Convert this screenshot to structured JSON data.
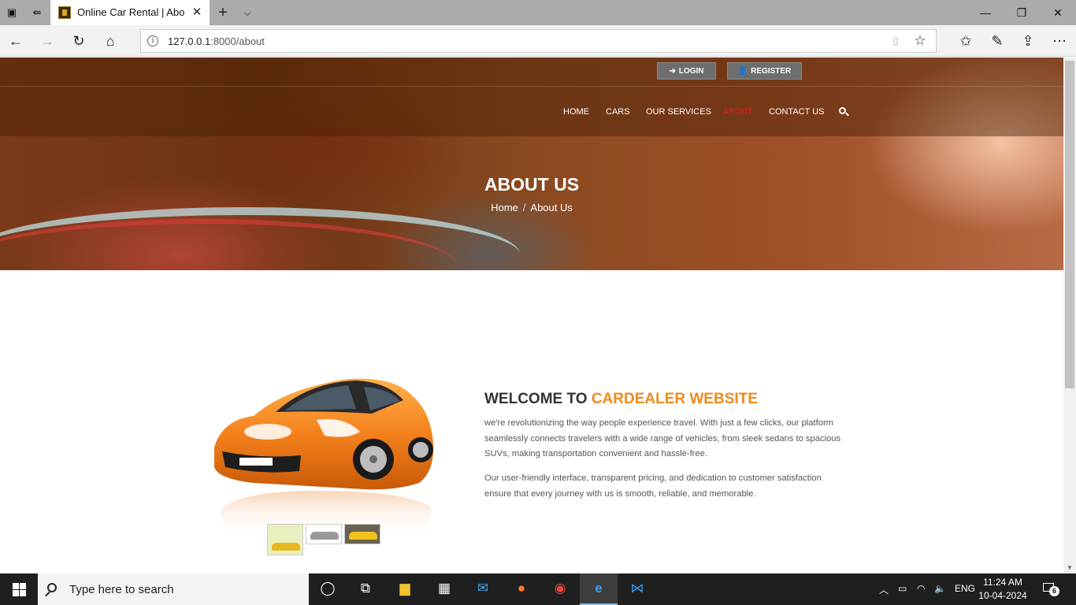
{
  "browser": {
    "tab_title": "Online Car Rental | About",
    "url_host": "127.0.0.1",
    "url_path": ":8000/about"
  },
  "header": {
    "login_label": "LOGIN",
    "register_label": "REGISTER",
    "menu": [
      {
        "label": "HOME",
        "active": false
      },
      {
        "label": "CARS",
        "active": false
      },
      {
        "label": "OUR SERVICES",
        "active": false
      },
      {
        "label": "ABOUT",
        "active": true
      },
      {
        "label": "CONTACT US",
        "active": false
      }
    ]
  },
  "hero": {
    "title": "ABOUT US",
    "breadcrumb_home": "Home",
    "breadcrumb_sep": "/",
    "breadcrumb_current": "About Us"
  },
  "about": {
    "heading_prefix": "WELCOME TO ",
    "heading_highlight": "CARDEALER WEBSITE",
    "paragraph_1": "we're revolutionizing the way people experience travel. With just a few clicks, our platform seamlessly connects travelers with a wide range of vehicles, from sleek sedans to spacious SUVs, making transportation convenient and hassle-free.",
    "paragraph_2": "Our user-friendly interface, transparent pricing, and dedication to customer satisfaction ensure that every journey with us is smooth, reliable, and memorable.",
    "accent_color": "#f08a1c"
  },
  "taskbar": {
    "search_placeholder": "Type here to search",
    "language": "ENG",
    "time": "11:24 AM",
    "date": "10-04-2024",
    "notifications": "6"
  }
}
